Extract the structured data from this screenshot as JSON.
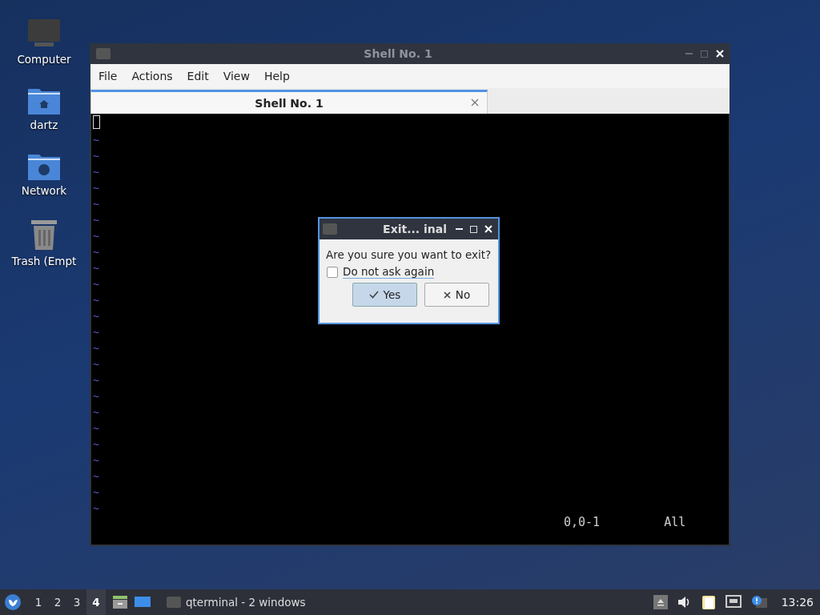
{
  "desktop_icons": [
    {
      "label": "Computer",
      "kind": "computer"
    },
    {
      "label": "dartz",
      "kind": "home"
    },
    {
      "label": "Network",
      "kind": "network"
    },
    {
      "label": "Trash (Empt",
      "kind": "trash"
    }
  ],
  "window": {
    "title": "Shell No. 1",
    "menu": [
      "File",
      "Actions",
      "Edit",
      "View",
      "Help"
    ],
    "tabs": [
      {
        "label": "Shell No. 1",
        "selected": true
      }
    ],
    "terminal": {
      "lines": [
        "~",
        "~",
        "~",
        "~",
        "~",
        "~",
        "~",
        "~",
        "~",
        "~",
        "~",
        "~",
        "~",
        "~",
        "~",
        "~",
        "~",
        "~",
        "~",
        "~",
        "~",
        "~",
        "~",
        "~"
      ],
      "position": "0,0-1",
      "scroll": "All"
    }
  },
  "dialog": {
    "title": "Exit... inal",
    "message": "Are you sure you want to exit?",
    "checkbox": {
      "label": "Do not ask again",
      "checked": false
    },
    "buttons": [
      {
        "label": "Yes",
        "kind": "confirm",
        "selected": true
      },
      {
        "label": "No",
        "kind": "cancel",
        "selected": false
      }
    ]
  },
  "taskbar": {
    "workspaces": [
      {
        "label": "1",
        "selected": false
      },
      {
        "label": "2",
        "selected": false
      },
      {
        "label": "3",
        "selected": false
      },
      {
        "label": "4",
        "selected": true
      }
    ],
    "task": "qterminal - 2 windows",
    "clock": "13:26"
  }
}
